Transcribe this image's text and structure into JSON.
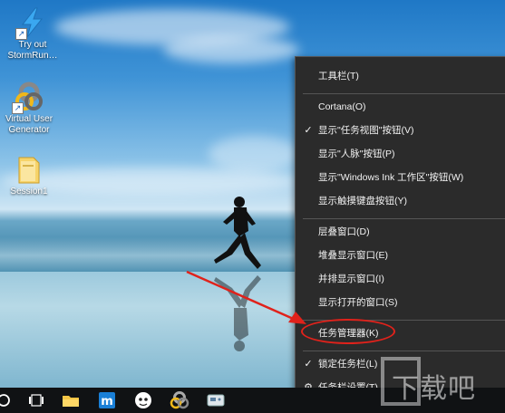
{
  "desktop": {
    "icons": [
      {
        "label": "Try out\nStormRun…",
        "icon": "stormrunner-lightning-icon"
      },
      {
        "label": "Virtual User\nGenerator",
        "icon": "vugen-icon"
      },
      {
        "label": "Session1",
        "icon": "folder-icon"
      }
    ]
  },
  "context_menu": {
    "items": [
      {
        "label": "工具栏(T)",
        "checked": false,
        "submenu": true
      },
      {
        "label": "Cortana(O)",
        "checked": false,
        "submenu": true
      },
      {
        "label": "显示\"任务视图\"按钮(V)",
        "checked": true
      },
      {
        "label": "显示\"人脉\"按钮(P)",
        "checked": false
      },
      {
        "label": "显示\"Windows Ink 工作区\"按钮(W)",
        "checked": false
      },
      {
        "label": "显示触摸键盘按钮(Y)",
        "checked": false
      },
      {
        "label": "层叠窗口(D)",
        "checked": false
      },
      {
        "label": "堆叠显示窗口(E)",
        "checked": false
      },
      {
        "label": "并排显示窗口(I)",
        "checked": false
      },
      {
        "label": "显示打开的窗口(S)",
        "checked": false
      },
      {
        "label": "任务管理器(K)",
        "checked": false,
        "highlighted": true
      },
      {
        "label": "锁定任务栏(L)",
        "checked": true
      },
      {
        "label": "任务栏设置(T)",
        "icon": "gear-icon"
      }
    ]
  },
  "taskbar": {
    "icons": [
      "cortana-circle-icon",
      "task-view-icon",
      "file-explorer-icon",
      "app-m-icon",
      "chat-face-icon",
      "vugen-icon",
      "controller-icon"
    ]
  },
  "watermark": {
    "text": "下载吧"
  },
  "colors": {
    "menu_bg": "#2b2b2b",
    "annotation_red": "#e0221b",
    "taskbar_bg": "#101214"
  }
}
